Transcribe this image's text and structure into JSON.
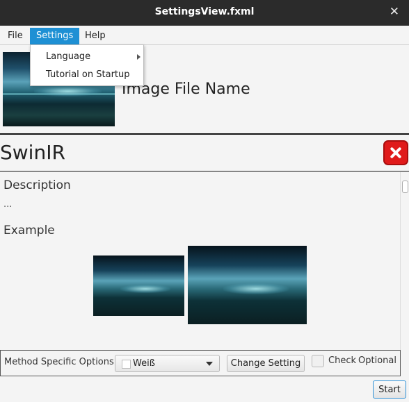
{
  "window": {
    "title": "SettingsView.fxml",
    "close_glyph": "✕"
  },
  "menubar": {
    "file": "File",
    "settings": "Settings",
    "help": "Help"
  },
  "settings_menu": {
    "language": "Language",
    "tutorial": "Tutorial on Startup"
  },
  "header": {
    "file_name": "Image File Name"
  },
  "method": {
    "title": "SwinIR",
    "description_label": "Description",
    "description_text": "...",
    "example_label": "Example"
  },
  "options": {
    "label": "Method Specific Options",
    "combo_value": "Weiß",
    "change_button": "Change Setting",
    "check_label": "Check",
    "optional_label": "Optional"
  },
  "footer": {
    "start_button": "Start"
  },
  "colors": {
    "accent": "#1e90d4",
    "close_red": "#e01a1a",
    "titlebar": "#2b2b2b"
  }
}
